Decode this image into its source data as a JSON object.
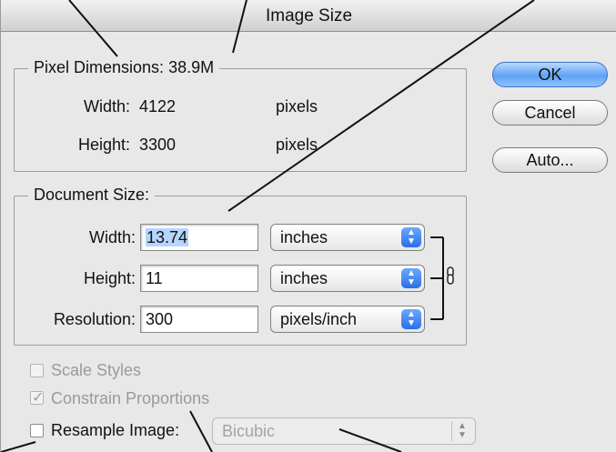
{
  "dialog": {
    "title": "Image Size"
  },
  "pixel_dimensions": {
    "legend": "Pixel Dimensions:",
    "size": "38.9M",
    "width_label": "Width:",
    "width_value": "4122",
    "width_unit": "pixels",
    "height_label": "Height:",
    "height_value": "3300",
    "height_unit": "pixels"
  },
  "document_size": {
    "legend": "Document Size:",
    "width_label": "Width:",
    "width_value": "13.74",
    "width_unit": "inches",
    "height_label": "Height:",
    "height_value": "11",
    "height_unit": "inches",
    "resolution_label": "Resolution:",
    "resolution_value": "300",
    "resolution_unit": "pixels/inch"
  },
  "buttons": {
    "ok": "OK",
    "cancel": "Cancel",
    "auto": "Auto..."
  },
  "options": {
    "scale_styles": "Scale Styles",
    "scale_styles_checked": false,
    "constrain_proportions": "Constrain Proportions",
    "constrain_proportions_checked": true,
    "resample_image": "Resample Image:",
    "resample_image_checked": false,
    "resample_method": "Bicubic"
  },
  "icons": {
    "link": "chain-link-icon",
    "popup_arrows": "up-down-arrows-icon",
    "checkmark": "checkmark-icon"
  },
  "colors": {
    "default_button": "#5fa2f5",
    "selection": "#b5d5ff",
    "popup_arrow": "#2c6ee8"
  }
}
